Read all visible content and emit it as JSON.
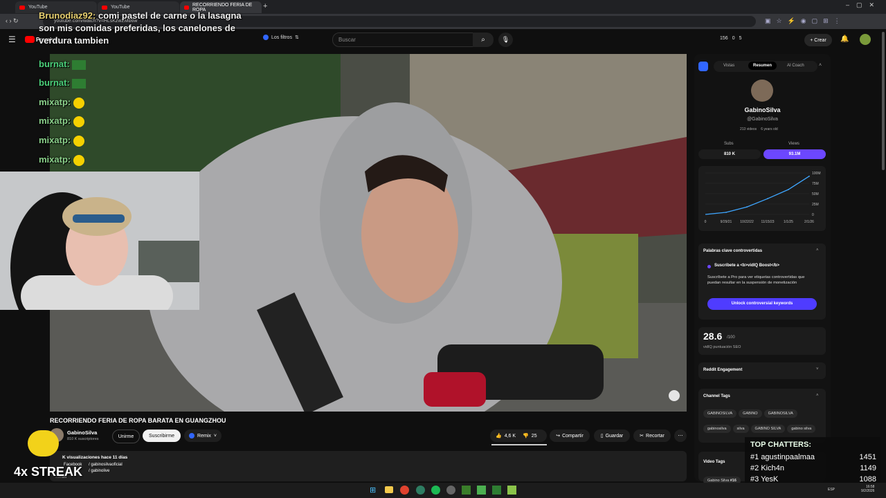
{
  "browser": {
    "tabs": [
      {
        "label": "YouTube",
        "active": false
      },
      {
        "label": "YouTube",
        "active": false
      },
      {
        "label": "RECORRIENDO FERIA DE ROPA",
        "active": true
      }
    ],
    "url": "youtube.com/watch?v=HLsKzwZMb6w"
  },
  "youtube": {
    "logo_label": "Premium",
    "filter_label": "Los filtros",
    "search_placeholder": "Buscar",
    "header_stats": [
      "156",
      "0",
      "5"
    ],
    "create_label": "Crear"
  },
  "video": {
    "title": "RECORRIENDO FERIA DE ROPA BARATA EN GUANGZHOU",
    "channel": "GabinoSilva",
    "subscribers": "810 K suscriptores",
    "join_label": "Unirme",
    "subscribe_label": "Suscribirme",
    "remix_label": "Remix",
    "likes": "4,6 K",
    "dislikes": "25",
    "share_label": "Compartir",
    "save_label": "Guardar",
    "clip_label": "Recortar",
    "description_line1": "K visualizaciones  hace 11 días",
    "description_line2": "Facebook",
    "description_line3": "/ gabinosilvaoficial",
    "description_line4": "/ gabinolive",
    "more_label": "...más"
  },
  "vidiq": {
    "tabs": [
      "Vistas",
      "Resumen",
      "AI Coach"
    ],
    "active_tab": "Resumen",
    "channel_name": "GabinoSilva",
    "handle": "@GabinoSilva",
    "videos": "213 videos",
    "age": "6 years old",
    "subs_label": "Subs",
    "subs_value": "810 K",
    "views_label": "Views",
    "views_value": "93.1M",
    "chart_y_labels": [
      "100M",
      "75M",
      "50M",
      "25M",
      "0"
    ],
    "chart_x_labels": [
      "0",
      "9/29/21",
      "10/22/22",
      "11/15/23",
      "1/1/25",
      "2/1/26"
    ],
    "controversial_title": "Palabras clave controvertidas",
    "boost_title": "Suscríbete a <b>vidIQ Boost</b>",
    "boost_text": "Suscríbete a Pro para ver etiquetas controvertidas que puedan resultar en la suspensión de monetización",
    "unlock_label": "Unlock controversial keywords",
    "seo_score": "28.6",
    "seo_max": "/100",
    "seo_label": "vidIQ puntuación SEO",
    "reddit_label": "Reddit Engagement",
    "channel_tags_label": "Channel Tags",
    "channel_tags": [
      "GABINOSILVA",
      "GABINO",
      "GABINOSILVA",
      "gabinosilva",
      "silva",
      "GABINO SILVA",
      "gabino silva"
    ],
    "video_tags_label": "Video Tags",
    "video_tag_first": "Gabino Silva",
    "video_tag_first_rank": "#16"
  },
  "chart_data": {
    "type": "line",
    "x": [
      "9/29/21",
      "10/22/22",
      "11/15/23",
      "1/1/25",
      "2/1/26"
    ],
    "values": [
      5,
      18,
      38,
      60,
      92
    ],
    "ylim": [
      0,
      100
    ],
    "ylabel": ""
  },
  "stream": {
    "chat": [
      {
        "user": "Brunodiaz92:",
        "text": "comi pastel de carne o la lasagna son mis comidas preferidas, los canelones de verdura tambien"
      },
      {
        "user": "burnat:",
        "text": ""
      },
      {
        "user": "burnat:",
        "text": ""
      },
      {
        "user": "mixatp:",
        "text": ""
      },
      {
        "user": "mixatp:",
        "text": ""
      },
      {
        "user": "mixatp:",
        "text": ""
      },
      {
        "user": "mixatp:",
        "text": ""
      }
    ],
    "streak_label": "4x STREAK",
    "top_chatters_title": "TOP CHATTERS:",
    "top_chatters": [
      {
        "rank": "#1",
        "name": "agustinpaalmaa",
        "count": "1451"
      },
      {
        "rank": "#2",
        "name": "Kich4n",
        "count": "1149"
      },
      {
        "rank": "#3",
        "name": "YesK",
        "count": "1088"
      }
    ]
  },
  "taskbar": {
    "lang": "ESP",
    "time": "16:58",
    "date": "9/2/2026"
  },
  "colors": {
    "accent_purple": "#6c47ff",
    "accent_blue": "#3166ff",
    "yt_red": "#ff0000"
  }
}
